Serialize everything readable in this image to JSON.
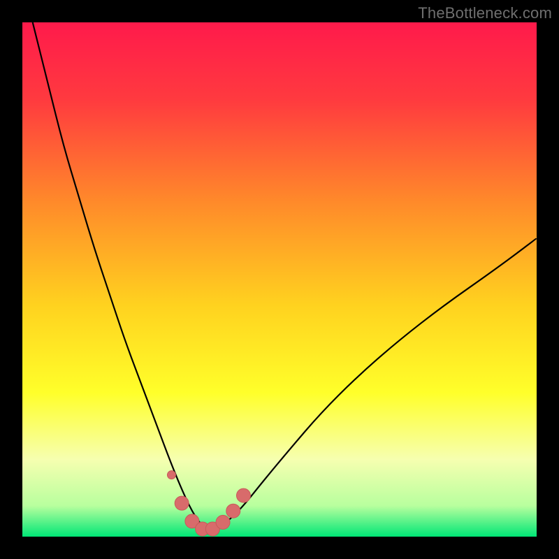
{
  "watermark": "TheBottleneck.com",
  "colors": {
    "frame": "#000000",
    "curve_stroke": "#000000",
    "marker_fill": "#d86b6b",
    "marker_stroke": "#c75a5a",
    "bottom_band": "#00e676"
  },
  "chart_data": {
    "type": "line",
    "title": "",
    "xlabel": "",
    "ylabel": "",
    "xlim": [
      0,
      100
    ],
    "ylim": [
      0,
      100
    ],
    "grid": false,
    "legend": false,
    "annotations": [],
    "series": [
      {
        "name": "bottleneck-curve",
        "x": [
          2,
          5,
          8,
          11,
          14,
          17,
          20,
          23,
          26,
          29,
          31.5,
          33.5,
          35.5,
          37.5,
          40,
          43,
          47,
          52,
          58,
          65,
          73,
          82,
          92,
          100
        ],
        "y": [
          100,
          88,
          76,
          66,
          56,
          47,
          38,
          30,
          22,
          14,
          8,
          4,
          1.5,
          1.5,
          3,
          6,
          11,
          17,
          24,
          31,
          38,
          45,
          52,
          58
        ]
      }
    ],
    "markers": {
      "name": "highlighted-points",
      "x": [
        29,
        31,
        33,
        35,
        37,
        39,
        41,
        43
      ],
      "y": [
        12,
        6.5,
        3,
        1.5,
        1.5,
        2.8,
        5,
        8
      ]
    },
    "background_gradient": [
      {
        "stop": 0.0,
        "color": "#ff1a4b"
      },
      {
        "stop": 0.15,
        "color": "#ff3a3f"
      },
      {
        "stop": 0.35,
        "color": "#ff8a2a"
      },
      {
        "stop": 0.55,
        "color": "#ffd21f"
      },
      {
        "stop": 0.72,
        "color": "#ffff2a"
      },
      {
        "stop": 0.85,
        "color": "#f6ffb0"
      },
      {
        "stop": 0.94,
        "color": "#b8ff9e"
      },
      {
        "stop": 1.0,
        "color": "#00e676"
      }
    ]
  }
}
